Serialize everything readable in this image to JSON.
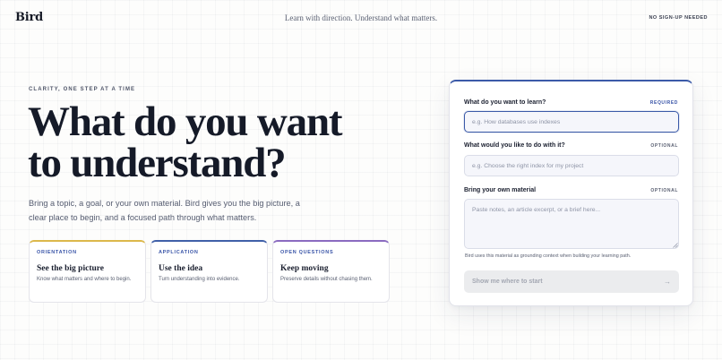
{
  "header": {
    "logo": "Bird",
    "tagline": "Learn with direction. Understand what matters.",
    "no_signup": "NO SIGN-UP NEEDED"
  },
  "hero": {
    "eyebrow": "CLARITY, ONE STEP AT A TIME",
    "title_line1": "What do you want",
    "title_line2": "to understand?",
    "description": "Bring a topic, a goal, or your own material. Bird gives you the big picture, a clear place to begin, and a focused path through what matters."
  },
  "cards": [
    {
      "tag": "ORIENTATION",
      "title": "See the big picture",
      "description": "Know what matters and where to begin.",
      "accent": "#dcb84b"
    },
    {
      "tag": "APPLICATION",
      "title": "Use the idea",
      "description": "Turn understanding into evidence.",
      "accent": "#4060a8"
    },
    {
      "tag": "OPEN QUESTIONS",
      "title": "Keep moving",
      "description": "Preserve details without chasing them.",
      "accent": "#8a6bc0"
    }
  ],
  "form": {
    "learn": {
      "label": "What do you want to learn?",
      "badge": "REQUIRED",
      "placeholder": "e.g. How databases use indexes",
      "value": ""
    },
    "goal": {
      "label": "What would you like to do with it?",
      "badge": "OPTIONAL",
      "placeholder": "e.g. Choose the right index for my project",
      "value": ""
    },
    "material": {
      "label": "Bring your own material",
      "badge": "OPTIONAL",
      "placeholder": "Paste notes, an article excerpt, or a brief here...",
      "value": ""
    },
    "help": "Bird uses this material as grounding context when building your learning path.",
    "submit_label": "Show me where to start",
    "submit_icon": "arrow-right-icon"
  },
  "colors": {
    "accent": "#3b5aa8",
    "background": "#fdfdfc",
    "button_disabled": "#ebecee"
  }
}
